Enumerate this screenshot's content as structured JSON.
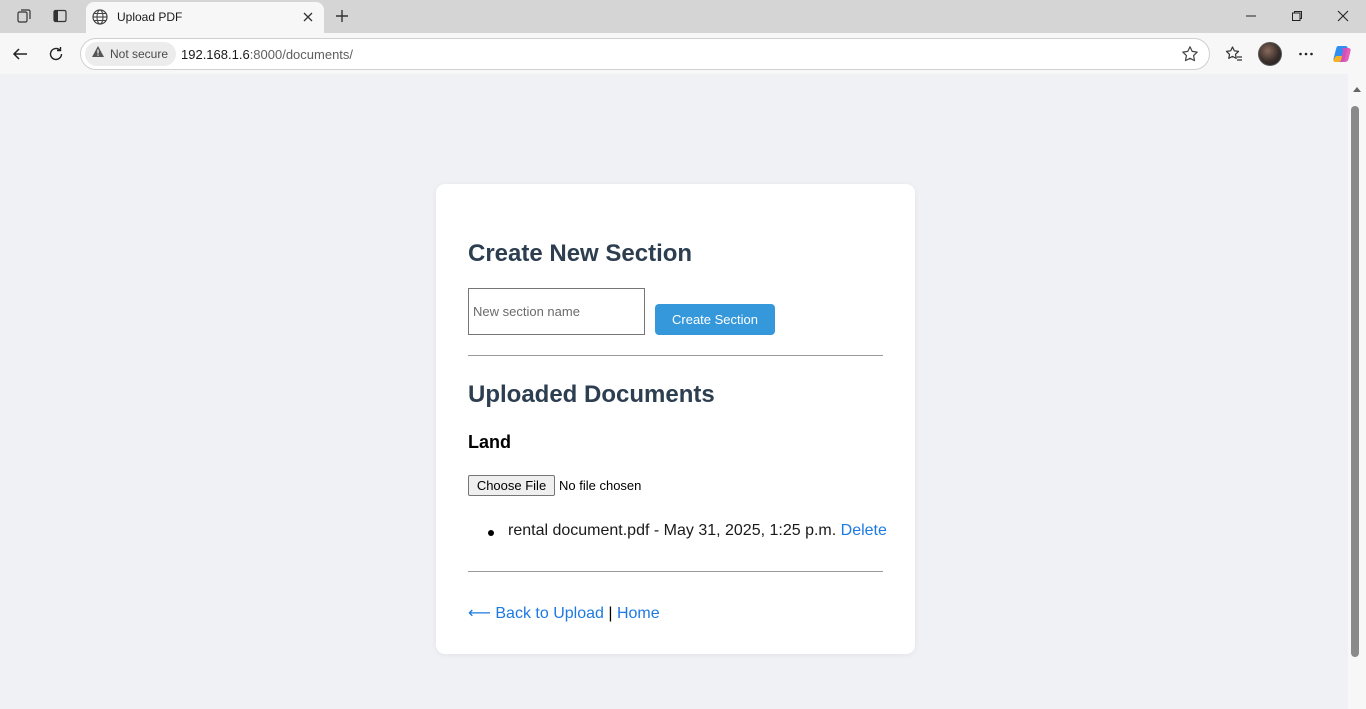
{
  "browser": {
    "tab": {
      "title": "Upload PDF"
    },
    "address": {
      "security_label": "Not secure",
      "url_host": "192.168.1.6",
      "url_rest": ":8000/documents/"
    }
  },
  "page": {
    "create_section": {
      "heading": "Create New Section",
      "input_placeholder": "New section name",
      "button_label": "Create Section"
    },
    "documents": {
      "heading": "Uploaded Documents",
      "sections": [
        {
          "name": "Land",
          "choose_file_label": "Choose File",
          "no_file_text": "No file chosen",
          "items": [
            {
              "text": "rental document.pdf - May 31, 2025, 1:25 p.m.",
              "delete_label": "Delete"
            }
          ]
        }
      ]
    },
    "footer": {
      "back_link": "⟵ Back to Upload",
      "separator": "|",
      "home_link": "Home"
    }
  },
  "colors": {
    "heading": "#2c3e50",
    "accent_button": "#3498db",
    "link": "#1d7ae2"
  }
}
